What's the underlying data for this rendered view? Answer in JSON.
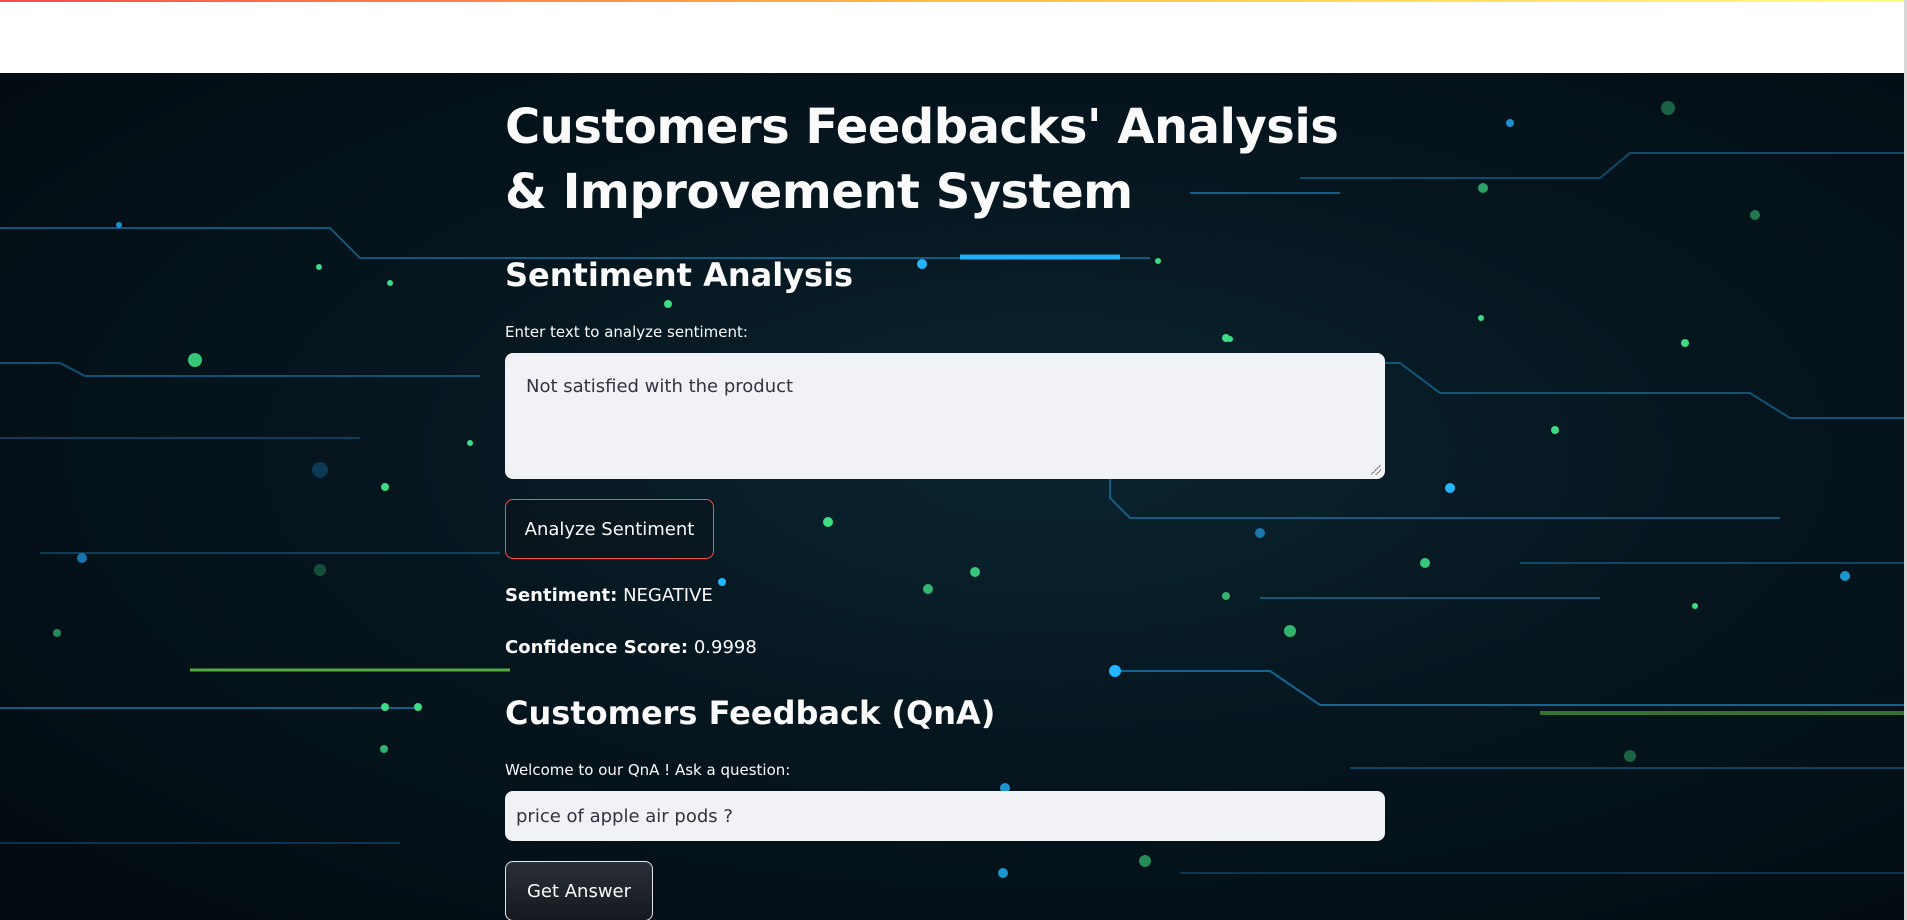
{
  "page": {
    "title": "Customers Feedbacks' Analysis & Improvement System"
  },
  "sentiment": {
    "heading": "Sentiment Analysis",
    "input_label": "Enter text to analyze sentiment:",
    "input_value": "Not satisfied with the product",
    "button_label": "Analyze Sentiment",
    "result_label": "Sentiment:",
    "result_value": "NEGATIVE",
    "confidence_label": "Confidence Score:",
    "confidence_value": "0.9998"
  },
  "qna": {
    "heading": "Customers Feedback (QnA)",
    "input_label": "Welcome to our QnA ! Ask a question:",
    "input_value": "price of apple air pods ?",
    "button_label": "Get Answer"
  },
  "colors": {
    "header_stripe_start": "#ff4b4b",
    "header_stripe_end": "#fffd80",
    "primary_button_border": "#ff4b4b",
    "input_background": "#f0f2f6",
    "text": "#fafafa"
  }
}
